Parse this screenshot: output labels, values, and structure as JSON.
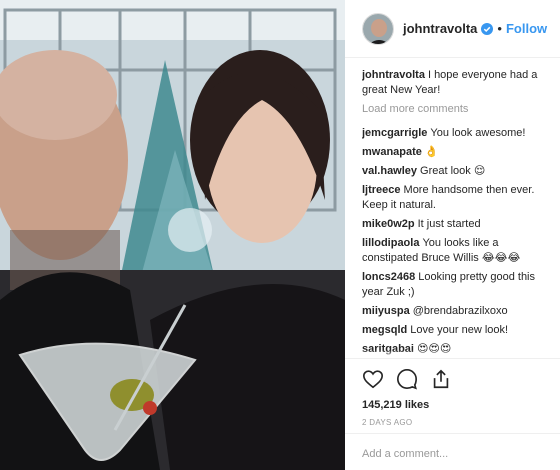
{
  "post": {
    "username": "johntravolta",
    "follow_label": "Follow",
    "dot": "•",
    "caption": "I hope everyone had a great New Year!",
    "load_more": "Load more comments",
    "comments": [
      {
        "user": "jemcgarrigle",
        "text": "You look awesome!"
      },
      {
        "user": "mwanapate",
        "text": "👌"
      },
      {
        "user": "val.hawley",
        "text": "Great look 😌"
      },
      {
        "user": "ljtreece",
        "text": "More handsome then ever. Keep it natural."
      },
      {
        "user": "mike0w2p",
        "text": "It just started"
      },
      {
        "user": "lillodipaola",
        "text": "You looks like a constipated Bruce Willis 😂😂😂"
      },
      {
        "user": "loncs2468",
        "text": "Looking pretty good this year Zuk ;)"
      },
      {
        "user": "miiyuspa",
        "text": "@brendabrazilxoxo"
      },
      {
        "user": "megsqld",
        "text": "Love your new look!"
      },
      {
        "user": "saritgabai",
        "text": "😍😍😍"
      }
    ],
    "likes": "145,219 likes",
    "date": "2 DAYS AGO",
    "add_comment_placeholder": "Add a comment..."
  },
  "icons": {
    "like": "heart-icon",
    "comment": "speech-bubble-icon",
    "share": "share-icon",
    "verified": "verified-badge-icon"
  },
  "colors": {
    "link_blue": "#3897f0",
    "muted": "#999999",
    "text": "#262626",
    "divider": "#efefef"
  }
}
